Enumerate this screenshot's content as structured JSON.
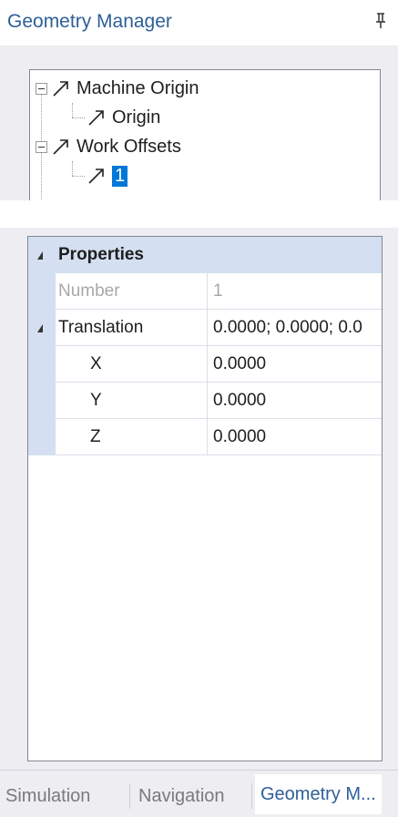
{
  "panel": {
    "title": "Geometry Manager",
    "pin_icon": "pin-icon"
  },
  "tree": {
    "nodes": [
      {
        "label": "Machine Origin",
        "expanded": true,
        "icon": "arrow-icon"
      },
      {
        "label": "Origin",
        "icon": "arrow-icon"
      },
      {
        "label": "Work Offsets",
        "expanded": true,
        "icon": "arrow-icon"
      },
      {
        "label": "1",
        "selected": true,
        "icon": "arrow-icon"
      }
    ]
  },
  "properties": {
    "category": "Properties",
    "rows": [
      {
        "name": "Number",
        "value": "1"
      },
      {
        "name": "Translation",
        "value": "0.0000; 0.0000; 0.0"
      },
      {
        "name": "X",
        "value": "0.0000"
      },
      {
        "name": "Y",
        "value": "0.0000"
      },
      {
        "name": "Z",
        "value": "0.0000"
      }
    ]
  },
  "tabs": [
    {
      "label": "Simulation"
    },
    {
      "label": "Navigation"
    },
    {
      "label": "Geometry M...",
      "active": true
    }
  ],
  "colors": {
    "accent": "#2f5f98",
    "selection": "#0078d7",
    "category_bg": "#d4e0f1",
    "panel_bg": "#eeeef2"
  }
}
